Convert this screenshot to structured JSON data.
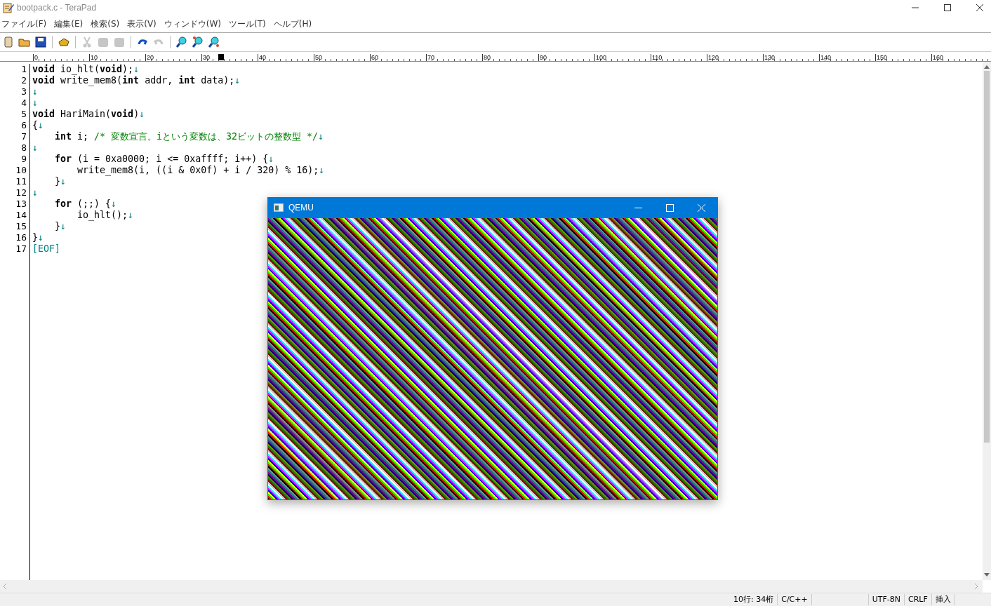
{
  "window": {
    "title": "bootpack.c - TeraPad"
  },
  "menu": [
    "ファイル(F)",
    "編集(E)",
    "検索(S)",
    "表示(V)",
    "ウィンドウ(W)",
    "ツール(T)",
    "ヘルプ(H)"
  ],
  "toolbar": [
    {
      "kind": "new",
      "disabled": false
    },
    {
      "kind": "open",
      "disabled": false
    },
    {
      "kind": "save",
      "disabled": false
    },
    {
      "kind": "separator"
    },
    {
      "kind": "print",
      "disabled": false
    },
    {
      "kind": "separator"
    },
    {
      "kind": "cut",
      "disabled": true
    },
    {
      "kind": "copy",
      "disabled": true
    },
    {
      "kind": "paste",
      "disabled": true
    },
    {
      "kind": "separator"
    },
    {
      "kind": "undo",
      "disabled": false
    },
    {
      "kind": "redo",
      "disabled": true
    },
    {
      "kind": "separator"
    },
    {
      "kind": "search",
      "disabled": false
    },
    {
      "kind": "search-next",
      "disabled": false
    },
    {
      "kind": "search-prev",
      "disabled": false
    }
  ],
  "ruler": [
    "0",
    "10",
    "20",
    "30",
    "40",
    "50",
    "60",
    "70",
    "80",
    "90",
    "100",
    "110",
    "120",
    "130",
    "140",
    "150",
    "160"
  ],
  "editor": {
    "lines": [
      {
        "number": "1",
        "tokens": [
          {
            "kind": "keyword",
            "text": "void"
          },
          {
            "kind": "text",
            "text": " io_hlt("
          },
          {
            "kind": "keyword",
            "text": "void"
          },
          {
            "kind": "text",
            "text": ");"
          },
          {
            "kind": "eol",
            "text": "↓"
          }
        ]
      },
      {
        "number": "2",
        "tokens": [
          {
            "kind": "keyword",
            "text": "void"
          },
          {
            "kind": "text",
            "text": " write_mem8("
          },
          {
            "kind": "keyword",
            "text": "int"
          },
          {
            "kind": "text",
            "text": " addr, "
          },
          {
            "kind": "keyword",
            "text": "int"
          },
          {
            "kind": "text",
            "text": " data);"
          },
          {
            "kind": "eol",
            "text": "↓"
          }
        ]
      },
      {
        "number": "3",
        "tokens": [
          {
            "kind": "eol",
            "text": "↓"
          }
        ]
      },
      {
        "number": "4",
        "tokens": [
          {
            "kind": "eol",
            "text": "↓"
          }
        ]
      },
      {
        "number": "5",
        "tokens": [
          {
            "kind": "keyword",
            "text": "void"
          },
          {
            "kind": "text",
            "text": " HariMain("
          },
          {
            "kind": "keyword",
            "text": "void"
          },
          {
            "kind": "text",
            "text": ")"
          },
          {
            "kind": "eol",
            "text": "↓"
          }
        ]
      },
      {
        "number": "6",
        "tokens": [
          {
            "kind": "text",
            "text": "{"
          },
          {
            "kind": "eol",
            "text": "↓"
          }
        ]
      },
      {
        "number": "7",
        "tokens": [
          {
            "kind": "keyword",
            "text": "    int"
          },
          {
            "kind": "text",
            "text": " i; "
          },
          {
            "kind": "comment",
            "text": "/* 変数宣言。iという変数は、32ビットの整数型 */"
          },
          {
            "kind": "eol",
            "text": "↓"
          }
        ]
      },
      {
        "number": "8",
        "tokens": [
          {
            "kind": "eol",
            "text": "↓"
          }
        ]
      },
      {
        "number": "9",
        "tokens": [
          {
            "kind": "keyword",
            "text": "    for"
          },
          {
            "kind": "text",
            "text": " (i = 0xa0000; i <= 0xaffff; i++) {"
          },
          {
            "kind": "eol",
            "text": "↓"
          }
        ]
      },
      {
        "number": "10",
        "tokens": [
          {
            "kind": "text",
            "text": "        write_mem8(i, ((i & 0x0f) + i / 320) % 16);"
          },
          {
            "kind": "eol",
            "text": "↓"
          }
        ]
      },
      {
        "number": "11",
        "tokens": [
          {
            "kind": "text",
            "text": "    }"
          },
          {
            "kind": "eol",
            "text": "↓"
          }
        ]
      },
      {
        "number": "12",
        "tokens": [
          {
            "kind": "eol",
            "text": "↓"
          }
        ]
      },
      {
        "number": "13",
        "tokens": [
          {
            "kind": "keyword",
            "text": "    for"
          },
          {
            "kind": "text",
            "text": " (;;) {"
          },
          {
            "kind": "eol",
            "text": "↓"
          }
        ]
      },
      {
        "number": "14",
        "tokens": [
          {
            "kind": "text",
            "text": "        io_hlt();"
          },
          {
            "kind": "eol",
            "text": "↓"
          }
        ]
      },
      {
        "number": "15",
        "tokens": [
          {
            "kind": "text",
            "text": "    }"
          },
          {
            "kind": "eol",
            "text": "↓"
          }
        ]
      },
      {
        "number": "16",
        "tokens": [
          {
            "kind": "text",
            "text": "}"
          },
          {
            "kind": "eol",
            "text": "↓"
          }
        ]
      },
      {
        "number": "17",
        "tokens": [
          {
            "kind": "eof",
            "text": "[EOF]"
          }
        ]
      }
    ]
  },
  "qemu_window": {
    "title": "QEMU"
  },
  "status_bar": {
    "segments": [
      {
        "kind": "position",
        "text": "10行: 34桁"
      },
      {
        "kind": "language",
        "text": "C/C++"
      },
      {
        "kind": "spacer"
      },
      {
        "kind": "encoding",
        "text": "UTF-8N"
      },
      {
        "kind": "newline",
        "text": "CRLF"
      },
      {
        "kind": "mode",
        "text": "挿入"
      }
    ]
  }
}
